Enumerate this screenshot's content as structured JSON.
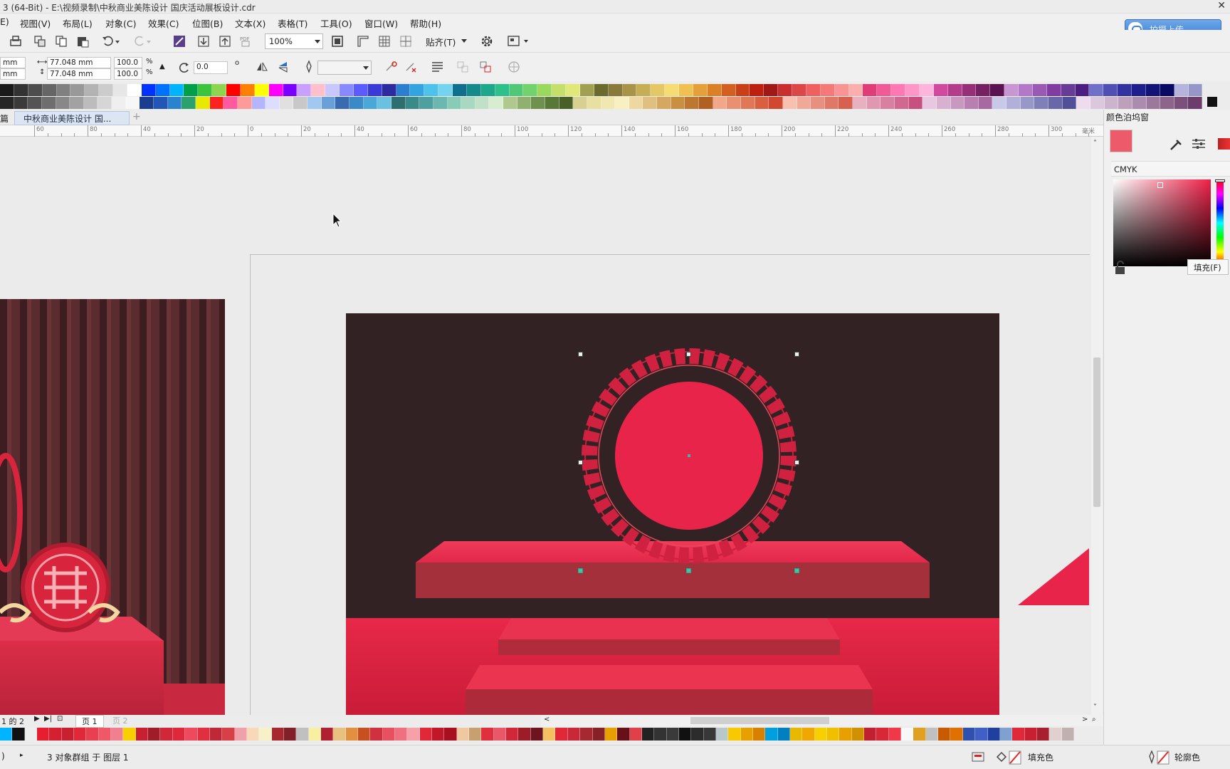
{
  "window": {
    "title": "3 (64-Bit) - E:\\视频录制\\中秋商业美陈设计 国庆活动展板设计.cdr"
  },
  "menu": [
    "E)",
    "视图(V)",
    "布局(L)",
    "对象(C)",
    "效果(C)",
    "位图(B)",
    "文本(X)",
    "表格(T)",
    "工具(O)",
    "窗口(W)",
    "帮助(H)"
  ],
  "upload": {
    "label": "拍摄上传"
  },
  "toolbar": {
    "zoom": "100%",
    "snap_label": "贴齐(T)"
  },
  "props": {
    "x_unit": "mm",
    "y_unit": "mm",
    "width": "77.048 mm",
    "height": "77.048 mm",
    "scale_w": "100.0",
    "scale_h": "100.0",
    "pct1": "%",
    "pct2": "%",
    "rotation": "0.0"
  },
  "tabs": {
    "left_stub": "篇",
    "active_doc": "中秋商业美陈设计 国..."
  },
  "ruler": [
    "60",
    "80",
    "40",
    "20",
    "0",
    "20",
    "40",
    "60",
    "80",
    "100",
    "120",
    "140",
    "160",
    "180",
    "200",
    "220",
    "240",
    "260",
    "280",
    "300"
  ],
  "ruler_unit": "毫米",
  "panel": {
    "title": "颜色泊坞窗",
    "model": "CMYK",
    "fill_button": "填充(F)",
    "fill_color": "#ed5a6a"
  },
  "pages": {
    "prefix": "1 的 2",
    "page1": "页 1",
    "page2": "页 2"
  },
  "status": {
    "left": ")",
    "message": "3 对象群组 于 图层 1",
    "fill_label": "填充色",
    "outline_label": "轮廓色"
  },
  "palette": {
    "row1": [
      "#1a1a1a",
      "#333",
      "#4d4d4d",
      "#666",
      "#808080",
      "#999",
      "#b3b3b3",
      "#ccc",
      "#e6e6e6",
      "#fff",
      "#0033ff",
      "#0072ff",
      "#00b4ff",
      "#00a04a",
      "#3cc43c",
      "#8ed44e",
      "#ff0000",
      "#ff7f00",
      "#ffff00",
      "#ff00ff",
      "#7a00ff",
      "#c8a0ff",
      "#ffc0cb",
      "#c8c8ff",
      "#8888ff",
      "#5b5bff",
      "#3a3ad6",
      "#2c2ca0",
      "#2a7fd0",
      "#34a4e0",
      "#4fc2e9",
      "#74d4f0",
      "#0f6f8f",
      "#158a8a",
      "#1ea78a",
      "#2fbf8a",
      "#50c878",
      "#72d26c",
      "#9ad95e",
      "#c4e06a",
      "#e0e878",
      "#a0a050",
      "#6b6b2e",
      "#8a7a3a",
      "#a89448",
      "#c6ae56",
      "#e4c864",
      "#f6dc72",
      "#f0c050",
      "#e6a03a",
      "#dc8028",
      "#d26020",
      "#c84018",
      "#be2010",
      "#a01818",
      "#c83030",
      "#dc4848",
      "#f06060",
      "#f47a7a",
      "#f89494",
      "#fcaeae",
      "#e03c78",
      "#f05a96",
      "#ff78b4",
      "#ff96c8",
      "#ffb4dc",
      "#d24aa0",
      "#b43c8c",
      "#962e78",
      "#782064",
      "#5a1250",
      "#c896d2",
      "#b478c8",
      "#9a5ab4",
      "#803ca0",
      "#663c96",
      "#4c1e82",
      "#7070c8",
      "#5050b4",
      "#3232a0",
      "#1e1e8c",
      "#141478",
      "#0a0a64",
      "#b4b4dc",
      "#9696c8"
    ],
    "row2": [
      "#262626",
      "#3a3a3a",
      "#545454",
      "#6e6e6e",
      "#888",
      "#a2a2a2",
      "#bcbcbc",
      "#d6d6d6",
      "#efefef",
      "#f7f7f7",
      "#1b3d8f",
      "#2156b8",
      "#2b82cf",
      "#2ca16d",
      "#e8e800",
      "#ff2020",
      "#ff5aa0",
      "#ff9a9a",
      "#b5b5ff",
      "#ddddff",
      "#e0e0e0",
      "#c8c8c8",
      "#a0c8f0",
      "#6aa0d8",
      "#3a6ab0",
      "#3a8ac8",
      "#4aa8d8",
      "#6ac0e0",
      "#2e6e6e",
      "#3a8a8a",
      "#4ea0a0",
      "#6cb8b0",
      "#88ccb8",
      "#a8d8c0",
      "#c0e0c8",
      "#d8ecd0",
      "#b0c890",
      "#90b070",
      "#709050",
      "#587838",
      "#486028",
      "#d8d090",
      "#e8e0a0",
      "#f0e8b0",
      "#f8f0c0",
      "#ecd8a0",
      "#e0c080",
      "#d4a860",
      "#c89040",
      "#bc7830",
      "#b06020",
      "#f0a888",
      "#e89070",
      "#e07858",
      "#d86040",
      "#d04830",
      "#f8c0b0",
      "#f0a898",
      "#e89080",
      "#e07868",
      "#d86050",
      "#e8b0c0",
      "#e098b0",
      "#d880a0",
      "#d06890",
      "#c85080",
      "#e8c8e0",
      "#d8b0d0",
      "#c898c0",
      "#b880b0",
      "#a868a0",
      "#c8c8e8",
      "#b0b0d8",
      "#9898c8",
      "#8080b8",
      "#6868a8",
      "#505098",
      "#ecdcec",
      "#dcc8dc",
      "#ccb4cc",
      "#bca0bc",
      "#ac8cac",
      "#9c789c",
      "#8c648c",
      "#7c507c",
      "#6c3c6c"
    ],
    "row3": [
      "#00b4ff",
      "#111",
      "#eee",
      "#e61e2e",
      "#d42030",
      "#c82030",
      "#e02838",
      "#e84050",
      "#f05868",
      "#f08090",
      "#f8d000",
      "#c82030",
      "#a01c28",
      "#d02838",
      "#e0283c",
      "#f0485c",
      "#e03040",
      "#c02838",
      "#d84048",
      "#f0a0a8",
      "#f8d8b8",
      "#f8f0c8",
      "#a82830",
      "#802028",
      "#c0c0c0",
      "#f8f0a0",
      "#b02030",
      "#e8c080",
      "#e09040",
      "#c85020",
      "#d03040",
      "#e85060",
      "#f07080",
      "#f8a0a8",
      "#e02838",
      "#c01828",
      "#a81020",
      "#f0c8a0",
      "#c8a070",
      "#e03040",
      "#e85868",
      "#d02838",
      "#9c1c28",
      "#6c1420",
      "#f4c060",
      "#e02838",
      "#c82838",
      "#a82830",
      "#882028",
      "#e8a000",
      "#681018",
      "#e04048",
      "#222",
      "#333",
      "#3a3a3a",
      "#111",
      "#2c2c2c",
      "#383838",
      "#b8c8c8",
      "#f8c800",
      "#e8a000",
      "#d88000",
      "#00a0e0",
      "#0080c0",
      "#e8b800",
      "#f0a800",
      "#f8d000",
      "#f0c000",
      "#e8a000",
      "#d09000",
      "#c02030",
      "#d82838",
      "#f03848",
      "#f8f8f8",
      "#e0a020",
      "#c0c0c0",
      "#c85a00",
      "#e07000",
      "#3050b0",
      "#4060c8",
      "#2040a0",
      "#80a0d0",
      "#e02838",
      "#c82030",
      "#a82030",
      "#e0d0d0",
      "#c0b0b0"
    ]
  }
}
